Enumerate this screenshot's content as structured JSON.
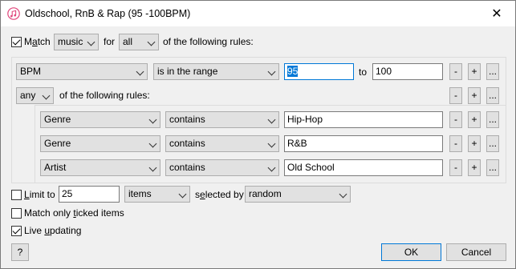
{
  "window": {
    "title": "Oldschool, RnB & Rap (95 -100BPM)",
    "close_glyph": "✕"
  },
  "match": {
    "checked": true,
    "label_pre": "M",
    "label_ul": "a",
    "label_post": "tch",
    "media_value": "music",
    "for_label": "for",
    "scope_value": "all",
    "suffix_label": "of the following rules:"
  },
  "rules": {
    "bpm": {
      "field": "BPM",
      "operator": "is in the range",
      "from_value": "95",
      "to_label": "to",
      "to_value": "100"
    },
    "nested": {
      "scope_value": "any",
      "suffix_label": "of the following rules:",
      "items": [
        {
          "field": "Genre",
          "operator": "contains",
          "value": "Hip-Hop"
        },
        {
          "field": "Genre",
          "operator": "contains",
          "value": "R&B"
        },
        {
          "field": "Artist",
          "operator": "contains",
          "value": "Old School"
        }
      ]
    },
    "buttons": {
      "remove": "-",
      "add": "+",
      "more": "..."
    }
  },
  "limit": {
    "checked": false,
    "label_ul": "L",
    "label_post": "imit to",
    "value": "25",
    "unit_value": "items",
    "selected_by_label_pre": "s",
    "selected_by_label_ul": "e",
    "selected_by_label_post": "lected by",
    "method_value": "random"
  },
  "ticked": {
    "checked": false,
    "label_pre": "Match only ",
    "label_ul": "t",
    "label_post": "icked items"
  },
  "live": {
    "checked": true,
    "label_pre": "Live ",
    "label_ul": "u",
    "label_post": "pdating"
  },
  "footer": {
    "help": "?",
    "ok": "OK",
    "cancel": "Cancel"
  },
  "colors": {
    "accent": "#0078d7",
    "button_face": "#e1e1e1",
    "dialog_bg": "#f0f0f0"
  }
}
